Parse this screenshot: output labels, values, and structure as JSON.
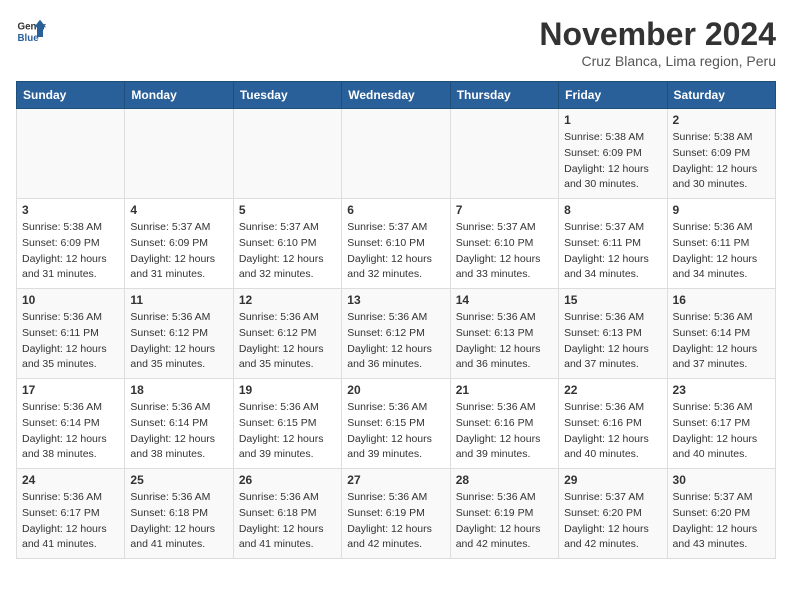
{
  "header": {
    "logo_line1": "General",
    "logo_line2": "Blue",
    "month_title": "November 2024",
    "location": "Cruz Blanca, Lima region, Peru"
  },
  "calendar": {
    "weekdays": [
      "Sunday",
      "Monday",
      "Tuesday",
      "Wednesday",
      "Thursday",
      "Friday",
      "Saturday"
    ],
    "rows": [
      [
        {
          "day": "",
          "details": ""
        },
        {
          "day": "",
          "details": ""
        },
        {
          "day": "",
          "details": ""
        },
        {
          "day": "",
          "details": ""
        },
        {
          "day": "",
          "details": ""
        },
        {
          "day": "1",
          "details": "Sunrise: 5:38 AM\nSunset: 6:09 PM\nDaylight: 12 hours and 30 minutes."
        },
        {
          "day": "2",
          "details": "Sunrise: 5:38 AM\nSunset: 6:09 PM\nDaylight: 12 hours and 30 minutes."
        }
      ],
      [
        {
          "day": "3",
          "details": "Sunrise: 5:38 AM\nSunset: 6:09 PM\nDaylight: 12 hours and 31 minutes."
        },
        {
          "day": "4",
          "details": "Sunrise: 5:37 AM\nSunset: 6:09 PM\nDaylight: 12 hours and 31 minutes."
        },
        {
          "day": "5",
          "details": "Sunrise: 5:37 AM\nSunset: 6:10 PM\nDaylight: 12 hours and 32 minutes."
        },
        {
          "day": "6",
          "details": "Sunrise: 5:37 AM\nSunset: 6:10 PM\nDaylight: 12 hours and 32 minutes."
        },
        {
          "day": "7",
          "details": "Sunrise: 5:37 AM\nSunset: 6:10 PM\nDaylight: 12 hours and 33 minutes."
        },
        {
          "day": "8",
          "details": "Sunrise: 5:37 AM\nSunset: 6:11 PM\nDaylight: 12 hours and 34 minutes."
        },
        {
          "day": "9",
          "details": "Sunrise: 5:36 AM\nSunset: 6:11 PM\nDaylight: 12 hours and 34 minutes."
        }
      ],
      [
        {
          "day": "10",
          "details": "Sunrise: 5:36 AM\nSunset: 6:11 PM\nDaylight: 12 hours and 35 minutes."
        },
        {
          "day": "11",
          "details": "Sunrise: 5:36 AM\nSunset: 6:12 PM\nDaylight: 12 hours and 35 minutes."
        },
        {
          "day": "12",
          "details": "Sunrise: 5:36 AM\nSunset: 6:12 PM\nDaylight: 12 hours and 35 minutes."
        },
        {
          "day": "13",
          "details": "Sunrise: 5:36 AM\nSunset: 6:12 PM\nDaylight: 12 hours and 36 minutes."
        },
        {
          "day": "14",
          "details": "Sunrise: 5:36 AM\nSunset: 6:13 PM\nDaylight: 12 hours and 36 minutes."
        },
        {
          "day": "15",
          "details": "Sunrise: 5:36 AM\nSunset: 6:13 PM\nDaylight: 12 hours and 37 minutes."
        },
        {
          "day": "16",
          "details": "Sunrise: 5:36 AM\nSunset: 6:14 PM\nDaylight: 12 hours and 37 minutes."
        }
      ],
      [
        {
          "day": "17",
          "details": "Sunrise: 5:36 AM\nSunset: 6:14 PM\nDaylight: 12 hours and 38 minutes."
        },
        {
          "day": "18",
          "details": "Sunrise: 5:36 AM\nSunset: 6:14 PM\nDaylight: 12 hours and 38 minutes."
        },
        {
          "day": "19",
          "details": "Sunrise: 5:36 AM\nSunset: 6:15 PM\nDaylight: 12 hours and 39 minutes."
        },
        {
          "day": "20",
          "details": "Sunrise: 5:36 AM\nSunset: 6:15 PM\nDaylight: 12 hours and 39 minutes."
        },
        {
          "day": "21",
          "details": "Sunrise: 5:36 AM\nSunset: 6:16 PM\nDaylight: 12 hours and 39 minutes."
        },
        {
          "day": "22",
          "details": "Sunrise: 5:36 AM\nSunset: 6:16 PM\nDaylight: 12 hours and 40 minutes."
        },
        {
          "day": "23",
          "details": "Sunrise: 5:36 AM\nSunset: 6:17 PM\nDaylight: 12 hours and 40 minutes."
        }
      ],
      [
        {
          "day": "24",
          "details": "Sunrise: 5:36 AM\nSunset: 6:17 PM\nDaylight: 12 hours and 41 minutes."
        },
        {
          "day": "25",
          "details": "Sunrise: 5:36 AM\nSunset: 6:18 PM\nDaylight: 12 hours and 41 minutes."
        },
        {
          "day": "26",
          "details": "Sunrise: 5:36 AM\nSunset: 6:18 PM\nDaylight: 12 hours and 41 minutes."
        },
        {
          "day": "27",
          "details": "Sunrise: 5:36 AM\nSunset: 6:19 PM\nDaylight: 12 hours and 42 minutes."
        },
        {
          "day": "28",
          "details": "Sunrise: 5:36 AM\nSunset: 6:19 PM\nDaylight: 12 hours and 42 minutes."
        },
        {
          "day": "29",
          "details": "Sunrise: 5:37 AM\nSunset: 6:20 PM\nDaylight: 12 hours and 42 minutes."
        },
        {
          "day": "30",
          "details": "Sunrise: 5:37 AM\nSunset: 6:20 PM\nDaylight: 12 hours and 43 minutes."
        }
      ]
    ]
  }
}
